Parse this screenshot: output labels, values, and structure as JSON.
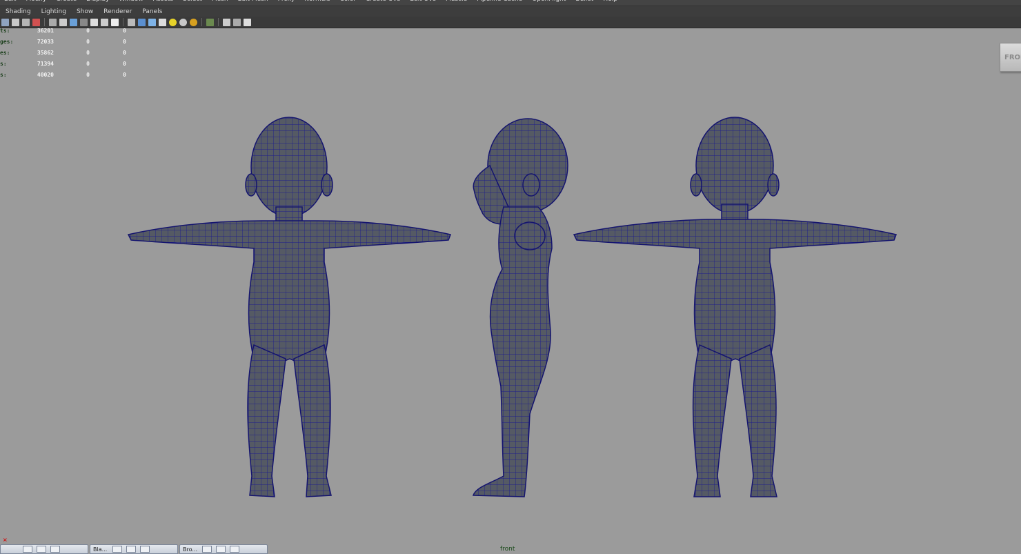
{
  "menubar": {
    "items": [
      "Edit",
      "Modify",
      "Create",
      "Display",
      "Window",
      "Assets",
      "Select",
      "Mesh",
      "Edit Mesh",
      "Proxy",
      "Normals",
      "Color",
      "Create UVs",
      "Edit UVs",
      "Muscle",
      "Pipeline Cache",
      "OpenFlight",
      "Bullet",
      "Help"
    ]
  },
  "panel_menu": {
    "items": [
      "Shading",
      "Lighting",
      "Show",
      "Renderer",
      "Panels"
    ]
  },
  "heads_up": {
    "rows": [
      {
        "label": "ts:",
        "values": [
          "36201",
          "0",
          "0"
        ]
      },
      {
        "label": "ges:",
        "values": [
          "72033",
          "0",
          "0"
        ]
      },
      {
        "label": "es:",
        "values": [
          "35862",
          "0",
          "0"
        ]
      },
      {
        "label": "s:",
        "values": [
          "71394",
          "0",
          "0"
        ]
      },
      {
        "label": "s:",
        "values": [
          "40020",
          "0",
          "0"
        ]
      }
    ]
  },
  "viewcube_label": "FRON",
  "viewport_camera": "front",
  "taskbar": [
    {
      "label": ""
    },
    {
      "label": "Bla..."
    },
    {
      "label": "Bro..."
    }
  ],
  "bottom_marker": "×",
  "colors": {
    "viewport_bg": "#9b9b9b",
    "mesh_fill": "#555a64",
    "wire": "#1e1e8c"
  }
}
